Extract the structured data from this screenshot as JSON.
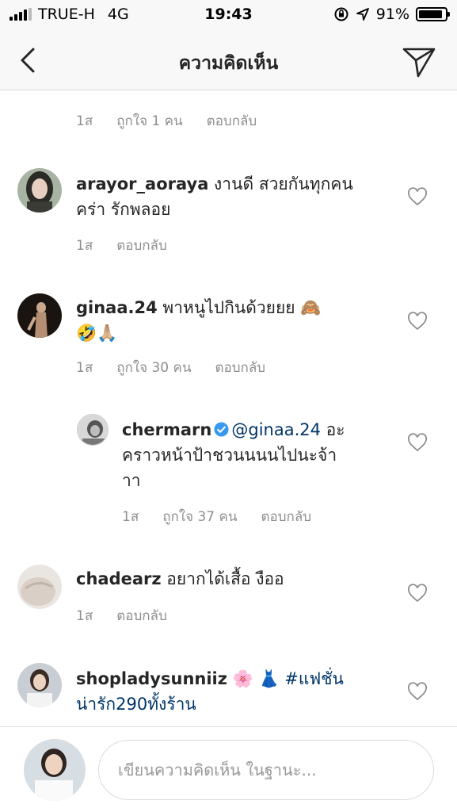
{
  "status_bar": {
    "carrier": "TRUE-H",
    "network": "4G",
    "time": "19:43",
    "battery": "91%",
    "battery_level": 0.91
  },
  "navbar": {
    "title": "ความคิดเห็น",
    "back_icon": "chevron-left-icon",
    "send_icon": "paper-plane-icon"
  },
  "top_meta": {
    "time": "1ส",
    "likes": "ถูกใจ 1 คน",
    "reply": "ตอบกลับ"
  },
  "comments": [
    {
      "username": "arayor_aoraya",
      "text": " งานดี สวยกันทุกคน",
      "text2": "คร่า รักพลอย",
      "time": "1ส",
      "reply": "ตอบกลับ"
    },
    {
      "username": "ginaa.24",
      "text": " พาหนูไปกินด้วยยย 🙈",
      "text2": "🤣🙏🏼",
      "time": "1ส",
      "likes": "ถูกใจ 30 คน",
      "reply": "ตอบกลับ"
    },
    {
      "username": "chermarn",
      "mention": "@ginaa.24",
      "text": " อะ",
      "text2": "คราวหน้าป้าชวนนนนไปนะจ้า",
      "text3": "าา",
      "time": "1ส",
      "likes": "ถูกใจ 37 คน",
      "reply": "ตอบกลับ"
    },
    {
      "username": "chadearz",
      "text": " อยากได้เสื้อ งืออ",
      "time": "1ส",
      "reply": "ตอบกลับ"
    },
    {
      "username": "shopladysunniiz",
      "emojis": " 🌸 👗 ",
      "hashtag": "#แฟชั่น",
      "hashtag2": "น่ารัก290ทั้งร้าน"
    }
  ],
  "composer": {
    "placeholder": "เขียนความคิดเห็น ในฐานะ..."
  },
  "colors": {
    "link": "#003569",
    "meta": "#8e8e8e",
    "verified": "#3897f0"
  }
}
